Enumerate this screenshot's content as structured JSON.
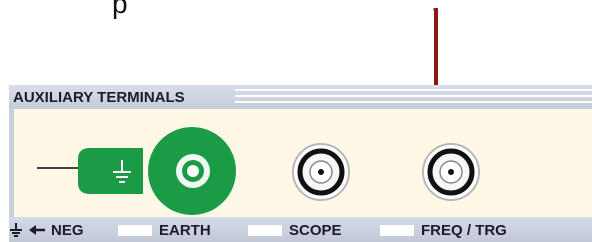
{
  "top_text": {
    "left_fragment": "p",
    "right_fragment": ","
  },
  "panel": {
    "title": "AUXILIARY TERMINALS",
    "footer": {
      "neg_label": "NEG",
      "earth_label": "EARTH",
      "scope_label": "SCOPE",
      "freq_trg_label": "FREQ / TRG"
    }
  },
  "icons": {
    "callout_arrow": "down-arrow-icon",
    "ground": "ground-icon",
    "neg_arrow": "left-arrow-icon"
  },
  "colors": {
    "arrow": "#8b1a14",
    "panel_background": "#fff8e6",
    "panel_frame": "#c8cfdd",
    "earth_terminal": "#1b9b45"
  }
}
